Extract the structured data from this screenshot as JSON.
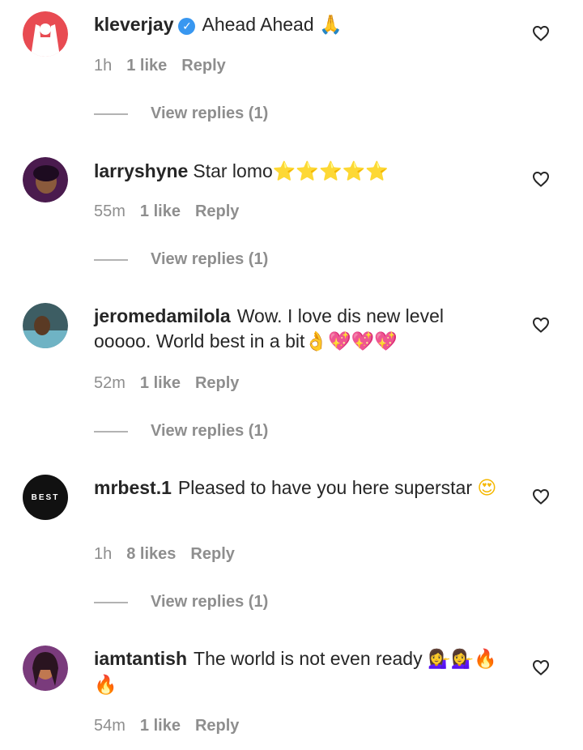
{
  "comments": [
    {
      "user": "kleverjay",
      "verified": true,
      "text": "Ahead Ahead",
      "emoji": "🙏",
      "time": "1h",
      "likes": "1 like",
      "reply": "Reply",
      "replies": "View replies (1)",
      "avatar_color": "#e84b52"
    },
    {
      "user": "larryshyne",
      "verified": false,
      "text": "Star lomo",
      "emoji": "⭐⭐⭐⭐⭐",
      "time": "55m",
      "likes": "1 like",
      "reply": "Reply",
      "replies": "View replies (1)",
      "avatar_color": "#4a1b4e"
    },
    {
      "user": "jeromedamilola",
      "verified": false,
      "text": "Wow. I love dis new level ooooo. World best in a bit",
      "emoji": "👌💖💖💖",
      "time": "52m",
      "likes": "1 like",
      "reply": "Reply",
      "replies": "View replies (1)",
      "avatar_color": "#3d5d63"
    },
    {
      "user": "mrbest.1",
      "verified": false,
      "text": "Pleased to have you here superstar",
      "emoji": "😍",
      "time": "1h",
      "likes": "8 likes",
      "reply": "Reply",
      "replies": "View replies (1)",
      "avatar_text": "BEST",
      "avatar_color": "#111111"
    },
    {
      "user": "iamtantish",
      "verified": false,
      "text": "The world is not even ready",
      "emoji": "💁‍♀️💁‍♀️🔥🔥",
      "time": "54m",
      "likes": "1 like",
      "reply": "Reply",
      "avatar_color": "#7a3b7c"
    }
  ]
}
